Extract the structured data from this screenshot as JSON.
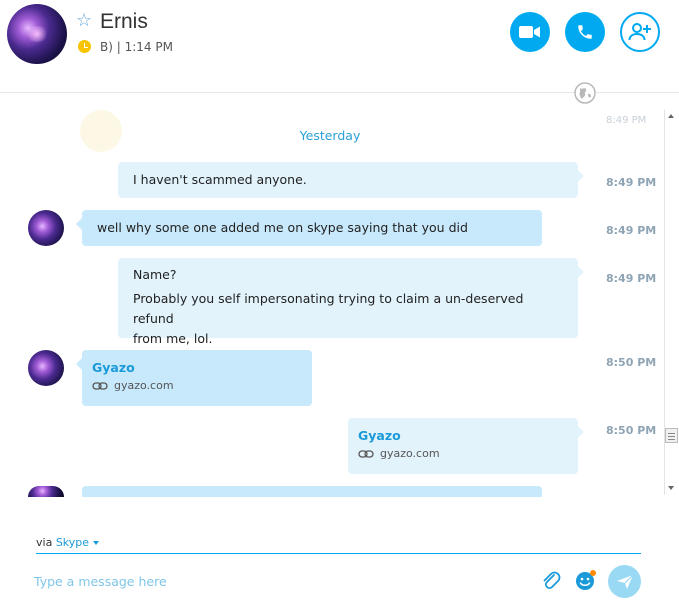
{
  "header": {
    "contact_name": "Ernis",
    "status_text": "B) | 1:14 PM",
    "avatar": "galaxy-avatar",
    "buttons": {
      "video_icon": "video-camera-icon",
      "call_icon": "phone-icon",
      "add_icon": "add-person-icon"
    }
  },
  "conversation": {
    "day_label": "Yesterday",
    "faded_time": "8:49 PM",
    "messages": [
      {
        "direction": "out",
        "text": "I haven't scammed anyone.",
        "time": "8:49 PM"
      },
      {
        "direction": "in",
        "text": "well why some one added me on skype saying that you did",
        "time": "8:49 PM"
      },
      {
        "direction": "out",
        "lines": [
          "Name?",
          "Probably you self impersonating trying to claim a un-deserved refund",
          "from me, lol."
        ],
        "time": "8:49 PM"
      },
      {
        "direction": "in",
        "link_title": "Gyazo",
        "link_url": "gyazo.com",
        "time": "8:50 PM"
      },
      {
        "direction": "out",
        "link_title": "Gyazo",
        "link_url": "gyazo.com",
        "time": "8:50 PM"
      }
    ]
  },
  "composer": {
    "via_label": "via",
    "via_service": "Skype",
    "placeholder": "Type a message here"
  },
  "colors": {
    "accent": "#00a9f0",
    "bubble_out": "#e2f3fc",
    "bubble_in": "#c8e9fb",
    "time_text": "#8fa4b4",
    "link": "#1a9ad8"
  }
}
